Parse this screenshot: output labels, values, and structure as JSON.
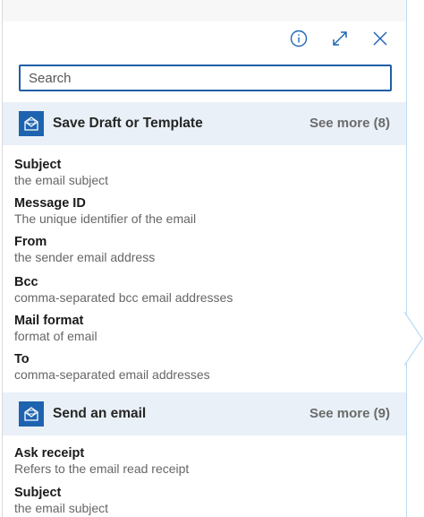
{
  "header": {
    "info_icon": "info-icon",
    "expand_icon": "expand-icon",
    "close_icon": "close-icon"
  },
  "search": {
    "placeholder": "Search",
    "value": ""
  },
  "sections": [
    {
      "title": "Save Draft or Template",
      "see_more": "See more (8)",
      "icon": "mail-icon",
      "fields": [
        {
          "name": "Subject",
          "desc": "the email subject"
        },
        {
          "name": "Message ID",
          "desc": "The unique identifier of the email"
        },
        {
          "name": "From",
          "desc": "the sender email address"
        },
        {
          "name": "Bcc",
          "desc": "comma-separated bcc email addresses"
        },
        {
          "name": "Mail format",
          "desc": "format of email"
        },
        {
          "name": "To",
          "desc": "comma-separated email addresses"
        }
      ]
    },
    {
      "title": "Send an email",
      "see_more": "See more (9)",
      "icon": "mail-icon",
      "fields": [
        {
          "name": "Ask receipt",
          "desc": "Refers to the email read receipt"
        },
        {
          "name": "Subject",
          "desc": "the email subject"
        }
      ]
    }
  ],
  "colors": {
    "accent": "#1e63b0",
    "section_bg": "#e9f0f7",
    "search_border": "#1f5fa6"
  }
}
